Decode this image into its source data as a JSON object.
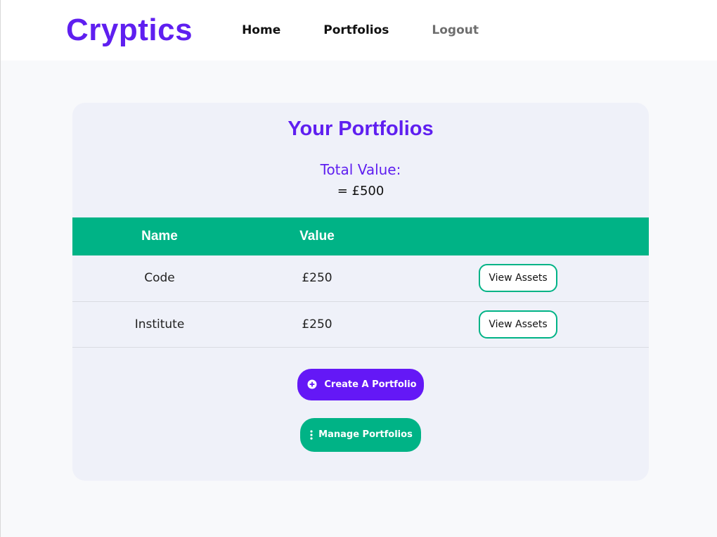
{
  "nav": {
    "brand": "Cryptics",
    "links": [
      "Home",
      "Portfolios",
      "Logout"
    ]
  },
  "card": {
    "title": "Your Portfolios",
    "total_label": "Total Value:",
    "total_value": "= £500"
  },
  "table": {
    "headers": [
      "Name",
      "Value",
      ""
    ],
    "rows": [
      {
        "name": "Code",
        "value": "£250",
        "action": "View Assets"
      },
      {
        "name": "Institute",
        "value": "£250",
        "action": "View Assets"
      }
    ]
  },
  "actions": {
    "create_label": "Create A Portfolio",
    "create_icon": "plus-circle-icon",
    "manage_label": "Manage Portfolios",
    "manage_icon": "vertical-dots-icon"
  },
  "colors": {
    "brand": "#5f1ff0",
    "accent": "#00b386",
    "create_button": "#6418f6"
  }
}
